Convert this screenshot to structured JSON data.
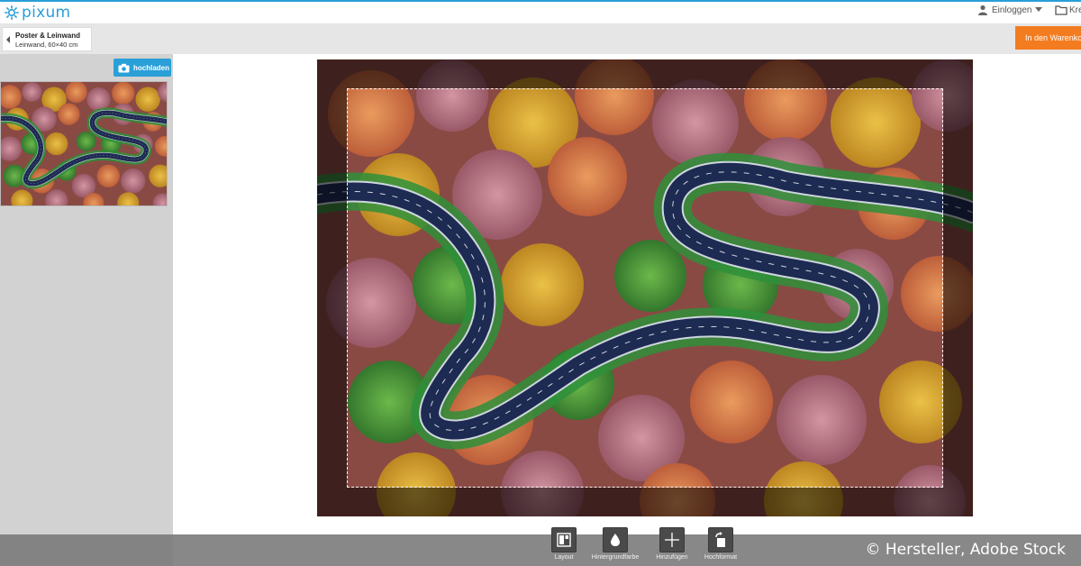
{
  "brand": {
    "name": "pixum",
    "accent": "#2a9fd8"
  },
  "header": {
    "login_label": "Einloggen",
    "projects_label": "Kre"
  },
  "product": {
    "title": "Poster & Leinwand",
    "subtitle": "Leinwand, 60×40 cm"
  },
  "cart": {
    "label": "In den Warenkorb",
    "color": "#f47c20"
  },
  "sidebar": {
    "upload_label": "hochladen"
  },
  "toolbar": {
    "items": [
      {
        "label": "Layout",
        "icon": "layout-icon"
      },
      {
        "label": "Hintergrundfarbe",
        "icon": "drop-icon"
      },
      {
        "label": "Hinzufügen",
        "icon": "plus-icon"
      },
      {
        "label": "Hochformat",
        "icon": "rotate-icon"
      }
    ]
  },
  "watermark": {
    "text": "© Hersteller, Adobe Stock"
  }
}
